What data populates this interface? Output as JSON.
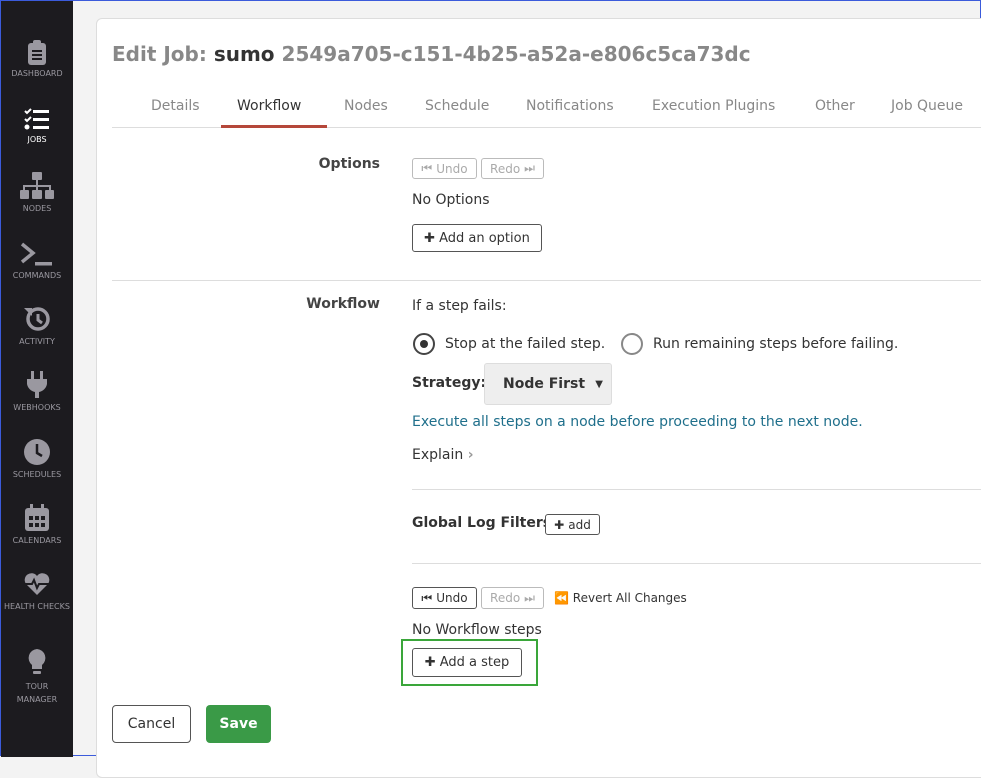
{
  "sidebar": {
    "items": [
      {
        "label": "DASHBOARD",
        "icon": "clipboard-icon"
      },
      {
        "label": "JOBS",
        "icon": "checklist-icon",
        "active": true
      },
      {
        "label": "NODES",
        "icon": "sitemap-icon"
      },
      {
        "label": "COMMANDS",
        "icon": "terminal-icon"
      },
      {
        "label": "ACTIVITY",
        "icon": "history-icon"
      },
      {
        "label": "WEBHOOKS",
        "icon": "plug-icon"
      },
      {
        "label": "SCHEDULES",
        "icon": "clock-icon"
      },
      {
        "label": "CALENDARS",
        "icon": "calendar-icon"
      },
      {
        "label": "HEALTH CHECKS",
        "icon": "heartbeat-icon"
      },
      {
        "label": "TOUR MANAGER",
        "icon": "lightbulb-icon"
      }
    ]
  },
  "header": {
    "prefix": "Edit Job:",
    "job_name": "sumo",
    "job_id": "2549a705-c151-4b25-a52a-e806c5ca73dc"
  },
  "tabs": [
    "Details",
    "Workflow",
    "Nodes",
    "Schedule",
    "Notifications",
    "Execution Plugins",
    "Other",
    "Job Queue"
  ],
  "active_tab": "Workflow",
  "options": {
    "label": "Options",
    "undo": "Undo",
    "redo": "Redo",
    "empty": "No Options",
    "add": "Add an option"
  },
  "workflow": {
    "label": "Workflow",
    "if_fails": "If a step fails:",
    "radio_stop": "Stop at the failed step.",
    "radio_run": "Run remaining steps before failing.",
    "selected": "stop",
    "strategy_label": "Strategy:",
    "strategy_value": "Node First",
    "strategy_desc": "Execute all steps on a node before proceeding to the next node.",
    "explain": "Explain",
    "log_filters": "Global Log Filters",
    "log_add": "add",
    "undo": "Undo",
    "redo": "Redo",
    "revert": "Revert All Changes",
    "empty": "No Workflow steps",
    "add_step": "Add a step"
  },
  "footer": {
    "cancel": "Cancel",
    "save": "Save"
  },
  "colors": {
    "accent": "#b5473a",
    "save": "#3a9a47",
    "link": "#1f6f8b",
    "highlight": "#3aa63a"
  }
}
